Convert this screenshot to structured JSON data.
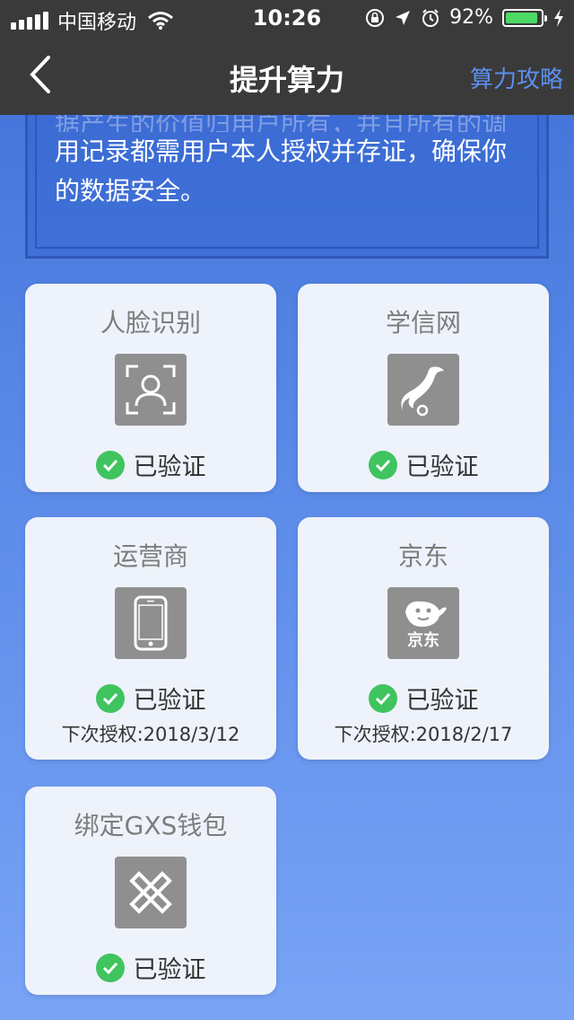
{
  "status_bar": {
    "carrier": "中国移动",
    "time": "10:26",
    "battery": "92%"
  },
  "nav": {
    "title": "提升算力",
    "right_link": "算力攻略"
  },
  "info": {
    "partial_line": "据产生的价值归用户所有，并且所有的调",
    "line2": "用记录都需用户本人授权并存证，确保你",
    "line3": "的数据安全。"
  },
  "cards": [
    {
      "title": "人脸识别",
      "icon": "face-scan-icon",
      "status": "已验证"
    },
    {
      "title": "学信网",
      "icon": "xuexin-bird-icon",
      "status": "已验证"
    },
    {
      "title": "运营商",
      "icon": "phone-icon",
      "status": "已验证",
      "next": "下次授权:2018/3/12"
    },
    {
      "title": "京东",
      "icon": "jd-logo-icon",
      "icon_text": "京东",
      "status": "已验证",
      "next": "下次授权:2018/2/17"
    },
    {
      "title": "绑定GXS钱包",
      "icon": "gxs-wallet-icon",
      "status": "已验证"
    }
  ],
  "colors": {
    "accent": "#5b8ff0",
    "verified": "#3fc45f",
    "topbar": "#3a3a3a"
  }
}
